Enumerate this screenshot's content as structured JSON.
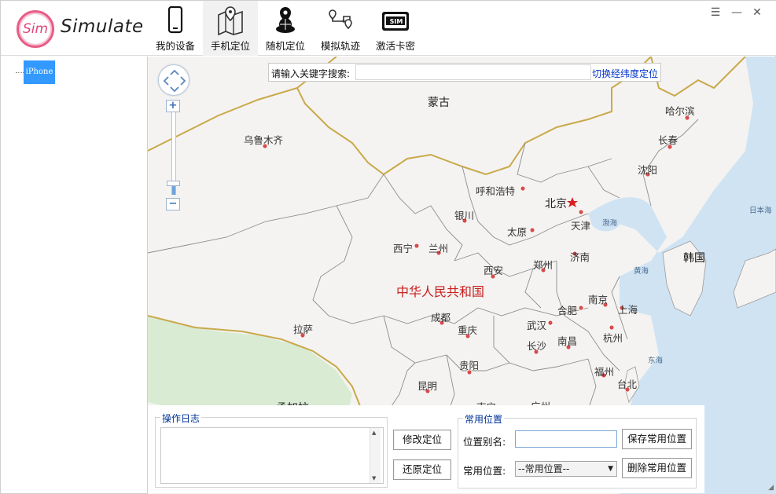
{
  "app": {
    "logo_text": "Sim",
    "brand": "Simulate"
  },
  "nav": [
    {
      "label": "我的设备",
      "icon": "phone-icon"
    },
    {
      "label": "手机定位",
      "icon": "map-pin-icon"
    },
    {
      "label": "随机定位",
      "icon": "globe-pin-icon"
    },
    {
      "label": "模拟轨迹",
      "icon": "route-icon"
    },
    {
      "label": "激活卡密",
      "icon": "sim-card-icon"
    }
  ],
  "window_controls": {
    "menu": "☰",
    "minimize": "—",
    "close": "✕"
  },
  "tree": {
    "device": "iPhone"
  },
  "search": {
    "label": "请输入关键字搜索:",
    "value": "",
    "switch_link": "切换经纬度定位"
  },
  "map_controls": {
    "zoom_in": "+",
    "zoom_out": "−"
  },
  "map_labels": {
    "mongolia": "蒙古",
    "china": "中华人民共和国",
    "korea": "韩国",
    "japan": "日本海",
    "bohai": "渤海",
    "yellow_sea": "黄海",
    "east_sea": "东海",
    "urumqi": "乌鲁木齐",
    "harbin": "哈尔滨",
    "changchun": "长春",
    "shenyang": "沈阳",
    "hohhot": "呼和浩特",
    "beijing": "北京",
    "tianjin": "天津",
    "yinchuan": "银川",
    "taiyuan": "太原",
    "xining": "西宁",
    "lanzhou": "兰州",
    "jinan": "济南",
    "zhengzhou": "郑州",
    "xian": "西安",
    "hefei": "合肥",
    "nanjing": "南京",
    "shanghai": "上海",
    "lhasa": "拉萨",
    "chengdu": "成都",
    "chongqing": "重庆",
    "wuhan": "武汉",
    "hangzhou": "杭州",
    "changsha": "长沙",
    "nanchang": "南昌",
    "guiyang": "贵阳",
    "fuzhou": "福州",
    "taipei": "台北",
    "kunming": "昆明",
    "nanning": "南宁",
    "guangzhou": "广州",
    "kathmandu": "孟加拉"
  },
  "log": {
    "title": "操作日志",
    "content": ""
  },
  "actions": {
    "modify": "修改定位",
    "restore": "还原定位"
  },
  "favorites": {
    "title": "常用位置",
    "alias_label": "位置别名:",
    "alias_value": "",
    "save_button": "保存常用位置",
    "select_label": "常用位置:",
    "select_value": "--常用位置--",
    "delete_button": "删除常用位置"
  },
  "colors": {
    "accent": "#3399ff",
    "logo": "#e0457a",
    "link": "#0033cc",
    "border_mongolia": "#c9a94a",
    "sea": "#cfe3f3",
    "green": "#cfe6c1"
  }
}
